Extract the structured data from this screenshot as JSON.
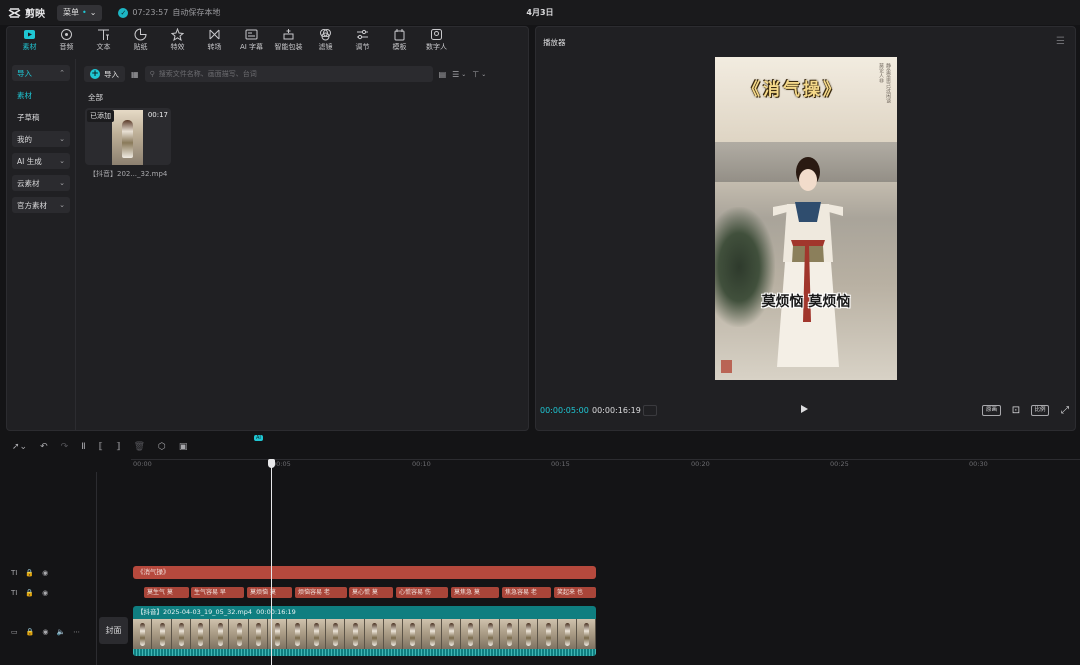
{
  "topbar": {
    "app_name": "剪映",
    "menu_label": "菜单",
    "menu_dot": "•",
    "save_time": "07:23:57",
    "save_text": "自动保存本地",
    "date": "4月3日"
  },
  "tools": [
    {
      "label": "素材",
      "icon": "media-icon",
      "active": true
    },
    {
      "label": "音频",
      "icon": "audio-icon"
    },
    {
      "label": "文本",
      "icon": "text-icon"
    },
    {
      "label": "贴纸",
      "icon": "sticker-icon"
    },
    {
      "label": "特效",
      "icon": "effects-icon"
    },
    {
      "label": "转场",
      "icon": "transition-icon"
    },
    {
      "label": "AI 字幕",
      "icon": "ai-caption-icon"
    },
    {
      "label": "智能包装",
      "icon": "smart-pack-icon"
    },
    {
      "label": "滤镜",
      "icon": "filter-icon"
    },
    {
      "label": "调节",
      "icon": "adjust-icon"
    },
    {
      "label": "模板",
      "icon": "template-icon"
    },
    {
      "label": "数字人",
      "icon": "avatar-icon"
    }
  ],
  "leftnav": {
    "import": "导入",
    "material": "素材",
    "draft": "子草稿",
    "mine": "我的",
    "ai_gen": "AI 生成",
    "cloud": "云素材",
    "official": "官方素材"
  },
  "media": {
    "import_label": "导入",
    "search_placeholder": "搜索文件名称、画面描写、台词",
    "section": "全部",
    "card": {
      "badge": "已添加",
      "duration": "00:17",
      "name": "【抖音】202..._32.mp4"
    }
  },
  "player": {
    "title": "播放器",
    "video_title": "《消气操》",
    "video_subtitle": "莫烦恼 莫烦恼",
    "time_current": "00:00:05:00",
    "time_total": "00:00:16:19",
    "btn_original": "原画",
    "btn_ratio": "比例"
  },
  "timeline": {
    "ai_tag": "AI",
    "ticks": [
      "00:00",
      "00:05",
      "00:10",
      "00:15",
      "00:20",
      "00:25",
      "00:30"
    ],
    "title_clip": "《消气操》",
    "subtitle_clips": [
      "莫生气 莫",
      "生气容易 早",
      "莫烦恼 莫",
      "烦恼容易 老",
      "莫心慌 莫",
      "心慌容易 伤",
      "莫焦急 莫",
      "焦急容易 老",
      "笑起来 也"
    ],
    "video_clip": "【抖音】2025-04-03_19_05_32.mp4",
    "video_clip_duration": "00:00:16:19",
    "cover_label": "封面"
  },
  "colors": {
    "accent": "#1fc7d4",
    "clip_red": "#b6493d",
    "clip_teal": "#0f7e80"
  }
}
